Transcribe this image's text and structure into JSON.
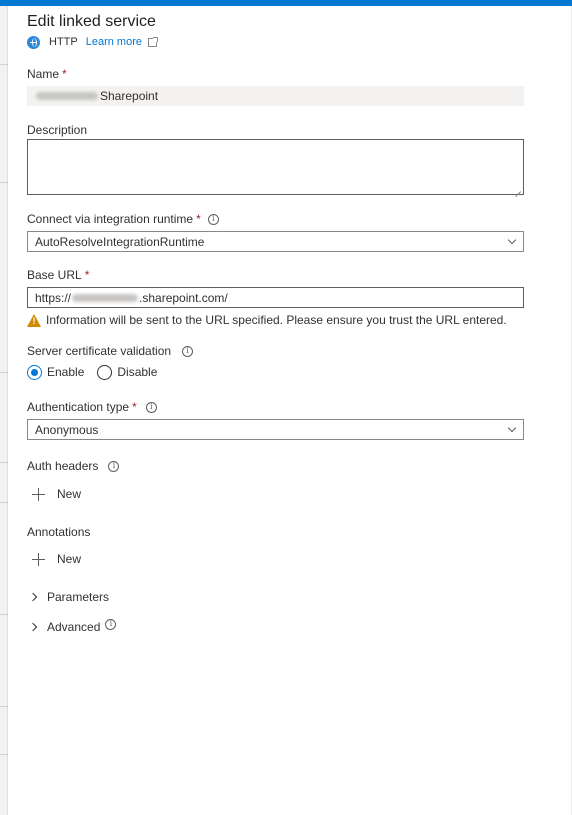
{
  "header": {
    "title": "Edit linked service",
    "connector_type": "HTTP",
    "learn_more": "Learn more"
  },
  "name": {
    "label": "Name",
    "value_suffix": "Sharepoint"
  },
  "description": {
    "label": "Description",
    "value": ""
  },
  "integration_runtime": {
    "label": "Connect via integration runtime",
    "selected": "AutoResolveIntegrationRuntime"
  },
  "base_url": {
    "label": "Base URL",
    "value_prefix": "https://",
    "value_suffix": ".sharepoint.com/",
    "warning": "Information will be sent to the URL specified. Please ensure you trust the URL entered."
  },
  "cert_validation": {
    "label": "Server certificate validation",
    "options": [
      "Enable",
      "Disable"
    ],
    "selected": "Enable"
  },
  "auth_type": {
    "label": "Authentication type",
    "selected": "Anonymous"
  },
  "auth_headers": {
    "label": "Auth headers",
    "new_label": "New"
  },
  "annotations": {
    "label": "Annotations",
    "new_label": "New"
  },
  "parameters": {
    "label": "Parameters"
  },
  "advanced": {
    "label": "Advanced"
  },
  "colors": {
    "accent": "#0078d4",
    "required": "#a4262c",
    "warning": "#d08a00"
  }
}
